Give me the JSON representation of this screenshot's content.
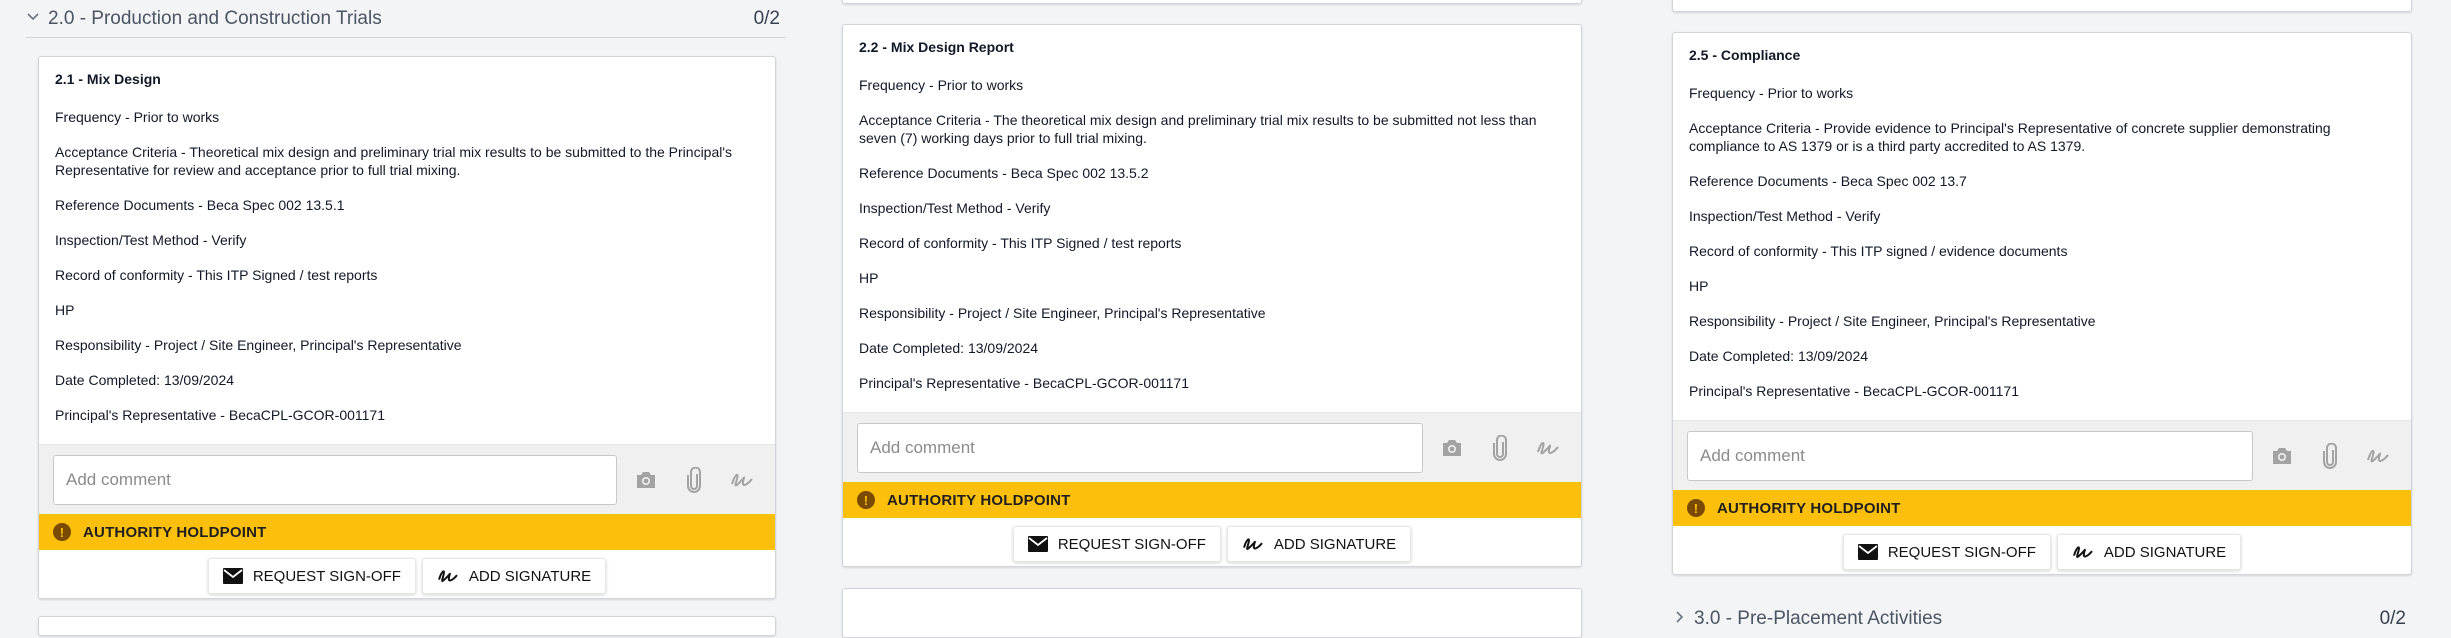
{
  "sections": {
    "s2": {
      "title": "2.0 - Production and Construction Trials",
      "count": "0/2"
    },
    "s3": {
      "title": "3.0 - Pre-Placement Activities",
      "count": "0/2"
    }
  },
  "common": {
    "comment_placeholder": "Add comment",
    "holdpoint_label": "AUTHORITY HOLDPOINT",
    "request_signoff_label": "REQUEST SIGN-OFF",
    "add_signature_label": "ADD SIGNATURE"
  },
  "cards": [
    {
      "title": "2.1 - Mix Design",
      "lines": [
        "Frequency - Prior to works",
        "Acceptance Criteria - Theoretical mix design and preliminary trial mix results to be submitted to the Principal's Representative for review and acceptance prior to full trial mixing.",
        "Reference Documents - Beca Spec 002 13.5.1",
        "Inspection/Test Method - Verify",
        "Record of conformity - This ITP Signed / test reports",
        "HP",
        "Responsibility - Project / Site Engineer, Principal's Representative",
        "Date Completed: 13/09/2024",
        "Principal's Representative - BecaCPL-GCOR-001171"
      ]
    },
    {
      "title": "2.2 - Mix Design Report",
      "lines": [
        "Frequency - Prior to works",
        "Acceptance Criteria - The theoretical mix design and preliminary trial mix results to be submitted not less than seven (7) working days prior to full trial mixing.",
        "Reference Documents - Beca Spec 002 13.5.2",
        "Inspection/Test Method - Verify",
        "Record of conformity - This ITP Signed / test reports",
        "HP",
        "Responsibility - Project / Site Engineer, Principal's Representative",
        "Date Completed: 13/09/2024",
        "Principal's Representative - BecaCPL-GCOR-001171"
      ]
    },
    {
      "title": "2.5 - Compliance",
      "lines": [
        "Frequency - Prior to works",
        "Acceptance Criteria - Provide evidence to Principal's Representative of concrete supplier demonstrating compliance to AS 1379 or is a third party accredited to AS 1379.",
        "Reference Documents - Beca Spec 002 13.7",
        "Inspection/Test Method - Verify",
        "Record of conformity - This ITP signed / evidence documents",
        "HP",
        "Responsibility - Project / Site Engineer, Principal's Representative",
        "Date Completed: 13/09/2024",
        "Principal's Representative - BecaCPL-GCOR-001171"
      ]
    }
  ],
  "icons": [
    "camera-icon",
    "paperclip-icon",
    "signature-icon",
    "exclamation-icon",
    "mail-icon",
    "chevron-down-icon",
    "chevron-right-icon"
  ],
  "colors": {
    "holdpoint": "#fbbf0c",
    "card_bg": "#ffffff",
    "page_bg": "#f3f4f6"
  }
}
